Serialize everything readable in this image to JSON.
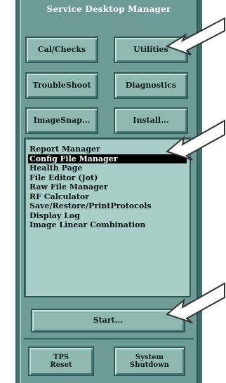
{
  "window": {
    "title": "Service Desktop Manager"
  },
  "buttons": {
    "cal_checks": "Cal/Checks",
    "utilities": "Utilities",
    "troubleshoot": "TroubleShoot",
    "diagnostics": "Diagnostics",
    "imagesnap": "ImageSnap...",
    "install": "Install...",
    "start": "Start...",
    "tps_reset": "TPS\nReset",
    "system_shutdown": "System\nShutdown"
  },
  "list": {
    "selected_index": 1,
    "items": [
      "Report Manager",
      "Config File Manager",
      "Health Page",
      "File Editor (Jot)",
      "Raw File Manager",
      "RF Calculator",
      "Save/Restore/PrintProtocols",
      "Display Log",
      "Image Linear Combination"
    ]
  },
  "colors": {
    "panel": "#6e9b96",
    "panel_frame": "#3f6d69",
    "button_face": "#8fb8b3",
    "listbox_bg": "#a9cdc8",
    "selection_bg": "#000000"
  },
  "annotations": {
    "arrow_icon": "callout-arrow-icon"
  }
}
